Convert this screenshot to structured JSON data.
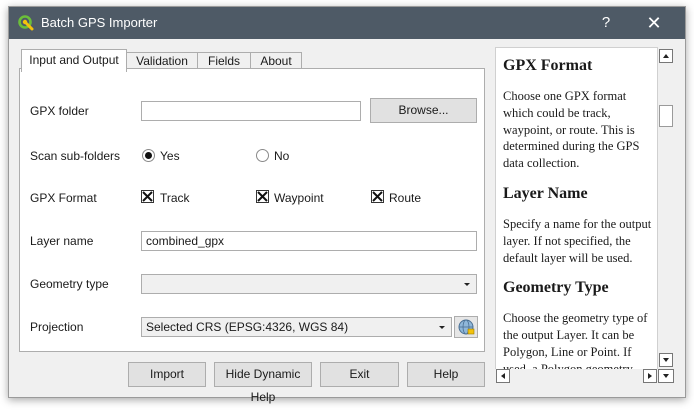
{
  "window": {
    "title": "Batch GPS Importer",
    "help_glyph": "?",
    "close_glyph": "✕"
  },
  "tabs": [
    {
      "label": "Input and Output",
      "active": true
    },
    {
      "label": "Validation",
      "active": false
    },
    {
      "label": "Fields",
      "active": false
    },
    {
      "label": "About",
      "active": false
    }
  ],
  "form": {
    "gpx_folder_label": "GPX folder",
    "gpx_folder_value": "",
    "browse_label": "Browse...",
    "scan_label": "Scan sub-folders",
    "scan_yes": "Yes",
    "scan_no": "No",
    "scan_selected": "Yes",
    "format_label": "GPX Format",
    "format_track": "Track",
    "format_waypoint": "Waypoint",
    "format_route": "Route",
    "layer_name_label": "Layer name",
    "layer_name_value": "combined_gpx",
    "geometry_label": "Geometry type",
    "geometry_value": "",
    "projection_label": "Projection",
    "projection_value": "Selected CRS (EPSG:4326, WGS 84)"
  },
  "buttons": {
    "import": "Import",
    "hide_help": "Hide Dynamic Help",
    "exit": "Exit",
    "help": "Help"
  },
  "help": {
    "gpx_format_heading": "GPX Format",
    "gpx_format_text": "Choose one GPX format which could be track, waypoint, or route. This is determined during the GPS data collection.",
    "layer_name_heading": "Layer Name",
    "layer_name_text": "Specify a name for the output layer. If not specified, the default layer will be used.",
    "geometry_heading": "Geometry Type",
    "geometry_text": "Choose the geometry type of the output Layer. It can be Polygon, Line or Point. If used, a Polygon geometry type will be ..."
  },
  "colors": {
    "titlebar": "#4e5a66",
    "window_bg": "#f0f0f0",
    "app_icon": "#6bbf3a"
  }
}
